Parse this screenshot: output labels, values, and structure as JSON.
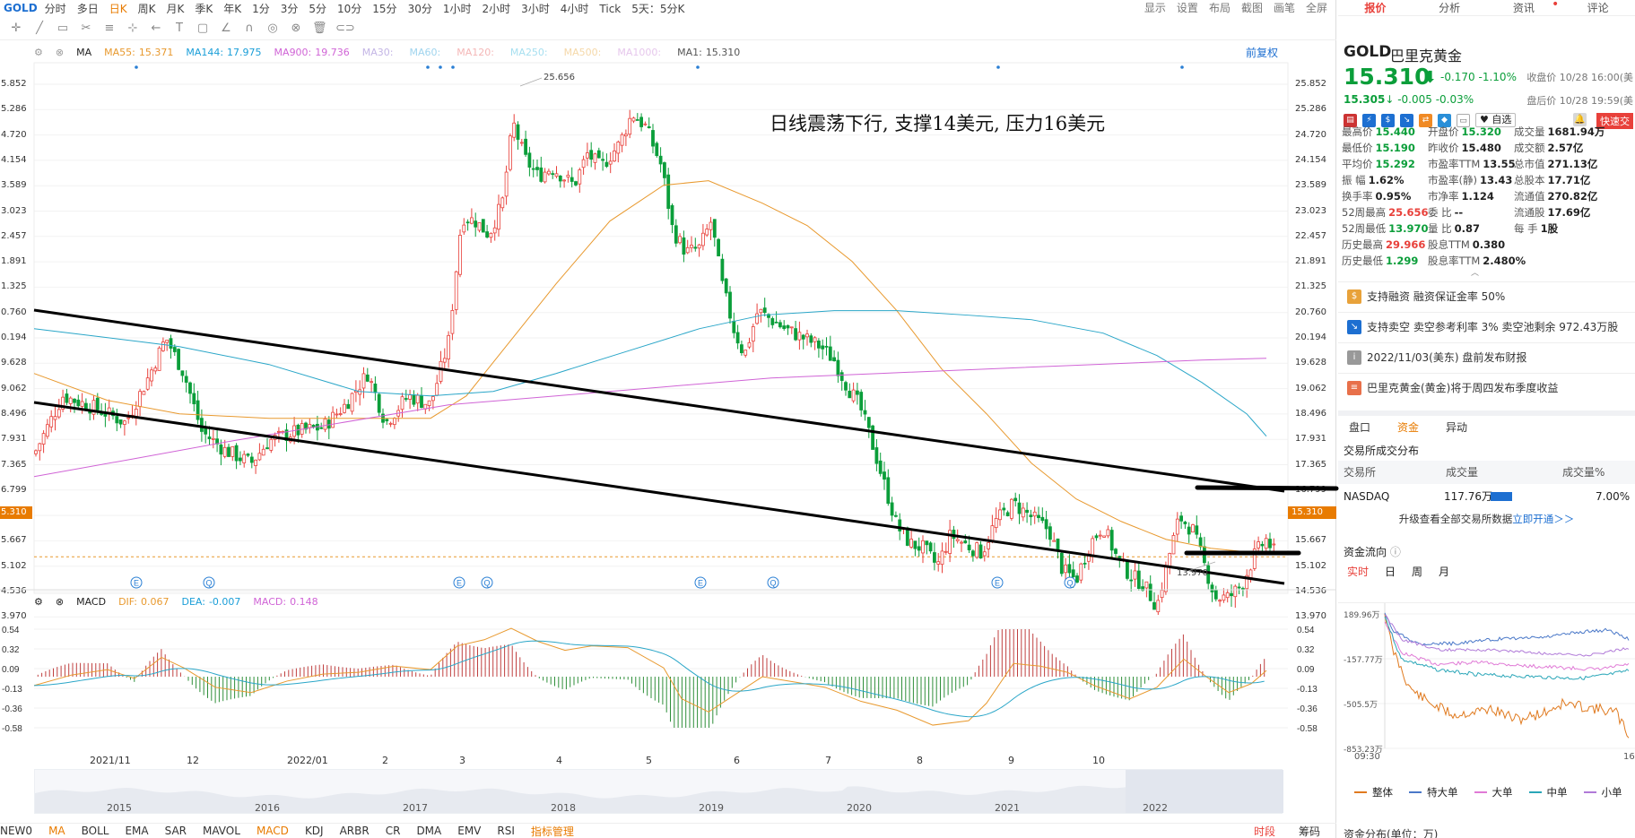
{
  "top": {
    "symbol": "GOLD",
    "periods": [
      "分时",
      "多日",
      "日K",
      "周K",
      "月K",
      "季K",
      "年K",
      "1分",
      "3分",
      "5分",
      "10分",
      "15分",
      "30分",
      "1小时",
      "2小时",
      "3小时",
      "4小时",
      "Tick",
      "5天：5分K"
    ],
    "active_period": "日K",
    "right_items": [
      "显示",
      "设置",
      "布局",
      "截图",
      "画笔",
      "全屏"
    ]
  },
  "toolbar_icons": [
    "crosshair-icon",
    "line-icon",
    "rect-icon",
    "fib-icon",
    "channel-icon",
    "measure-icon",
    "arrow-icon",
    "text-icon",
    "comment-icon",
    "ruler-icon",
    "magnet-icon",
    "eye-icon",
    "lock-icon",
    "trash-icon",
    "group-icon"
  ],
  "main_legend": {
    "name": "MA",
    "items": [
      {
        "label": "MA55:",
        "value": "15.371",
        "color": "#e8992e"
      },
      {
        "label": "MA144:",
        "value": "17.975",
        "color": "#1a9ed8"
      },
      {
        "label": "MA900:",
        "value": "19.736",
        "color": "#d064d6"
      },
      {
        "label": "MA30:",
        "value": "",
        "color": "#c3b5e5"
      },
      {
        "label": "MA60:",
        "value": "",
        "color": "#9fd4ee"
      },
      {
        "label": "MA120:",
        "value": "",
        "color": "#f4b7b7"
      },
      {
        "label": "MA250:",
        "value": "",
        "color": "#a6dff0"
      },
      {
        "label": "MA500:",
        "value": "",
        "color": "#f5d8a8"
      },
      {
        "label": "MA1000:",
        "value": "",
        "color": "#e6c7ec"
      },
      {
        "label": "MA1:",
        "value": "15.310",
        "color": "#555555"
      }
    ],
    "recover": "前复权"
  },
  "yaxis": [
    "25.852",
    "25.286",
    "24.720",
    "24.154",
    "23.589",
    "23.023",
    "22.457",
    "21.891",
    "21.325",
    "20.760",
    "20.194",
    "19.628",
    "19.062",
    "18.496",
    "17.931",
    "17.365",
    "16.799",
    "16.233",
    "15.667",
    "15.102",
    "14.536",
    "13.970"
  ],
  "yaxis_left": [
    "5.852",
    "5.286",
    "4.720",
    "4.154",
    "3.589",
    "3.023",
    "2.457",
    "1.891",
    "1.325",
    "0.760",
    "0.194",
    "9.628",
    "9.062",
    "8.496",
    "7.931",
    "7.365",
    "6.799",
    "6.233",
    "5.667",
    "5.102",
    "4.536",
    "3.970"
  ],
  "current_price_left": "5.310",
  "current_price_right": "15.310",
  "annotation": "日线震荡下行, 支撑14美元, 压力16美元",
  "high_label": "25.656",
  "low_label": "13.970",
  "event_markers": [
    "E",
    "Q",
    "E",
    "Q",
    "E",
    "Q",
    "E",
    "Q"
  ],
  "macd_legend": {
    "name": "MACD",
    "items": [
      {
        "label": "DIF:",
        "value": "0.067",
        "color": "#e8992e"
      },
      {
        "label": "DEA:",
        "value": "-0.007",
        "color": "#1a9ed8"
      },
      {
        "label": "MACD:",
        "value": "0.148",
        "color": "#d064d6"
      }
    ]
  },
  "macd_axis": [
    "0.54",
    "0.32",
    "0.09",
    "-0.13",
    "-0.36",
    "-0.58"
  ],
  "xaxis": [
    "2021/11",
    "12",
    "2022/01",
    "2",
    "3",
    "4",
    "5",
    "6",
    "7",
    "8",
    "9",
    "10"
  ],
  "overview_years": [
    "2015",
    "2016",
    "2017",
    "2018",
    "2019",
    "2020",
    "2021",
    "2022"
  ],
  "indicators": [
    "NEW0",
    "MA",
    "BOLL",
    "EMA",
    "SAR",
    "MAVOL",
    "MACD",
    "KDJ",
    "ARBR",
    "CR",
    "DMA",
    "EMV",
    "RSI",
    "指标管理"
  ],
  "active_indicators": [
    "MA",
    "MACD",
    "指标管理"
  ],
  "indicator_right": [
    "时段",
    "筹码"
  ],
  "right": {
    "tabs": [
      "报价",
      "分析",
      "资讯",
      "评论"
    ],
    "active_tab": "报价",
    "ticker": "GOLD",
    "name_cn": "巴里克黄金",
    "price": "15.310",
    "change": "-0.170",
    "change_pct": "-1.10%",
    "close_time": "收盘价 10/28 16:00(美",
    "after_price": "15.305",
    "after_change": "-0.005",
    "after_pct": "-0.03%",
    "after_time": "盘后价 10/28 19:59(美",
    "watch_label": "自选",
    "quick_trade": "快速交",
    "stats": [
      [
        {
          "k": "最高价",
          "v": "15.440",
          "c": "dn"
        },
        {
          "k": "开盘价",
          "v": "15.320",
          "c": "dn"
        },
        {
          "k": "成交量",
          "v": "1681.94万",
          "c": ""
        }
      ],
      [
        {
          "k": "最低价",
          "v": "15.190",
          "c": "dn"
        },
        {
          "k": "昨收价",
          "v": "15.480",
          "c": ""
        },
        {
          "k": "成交额",
          "v": "2.57亿",
          "c": ""
        }
      ],
      [
        {
          "k": "平均价",
          "v": "15.292",
          "c": "dn"
        },
        {
          "k": "市盈率TTM",
          "v": "13.55",
          "c": ""
        },
        {
          "k": "总市值",
          "v": "271.13亿",
          "c": ""
        }
      ],
      [
        {
          "k": "振    幅",
          "v": "1.62%",
          "c": ""
        },
        {
          "k": "市盈率(静)",
          "v": "13.43",
          "c": ""
        },
        {
          "k": "总股本",
          "v": "17.71亿",
          "c": ""
        }
      ],
      [
        {
          "k": "换手率",
          "v": "0.95%",
          "c": ""
        },
        {
          "k": "市净率",
          "v": "1.124",
          "c": ""
        },
        {
          "k": "流通值",
          "v": "270.82亿",
          "c": ""
        }
      ],
      [
        {
          "k": "52周最高",
          "v": "25.656",
          "c": "up"
        },
        {
          "k": "委    比",
          "v": "--",
          "c": ""
        },
        {
          "k": "流通股",
          "v": "17.69亿",
          "c": ""
        }
      ],
      [
        {
          "k": "52周最低",
          "v": "13.970",
          "c": "dn"
        },
        {
          "k": "量    比",
          "v": "0.87",
          "c": ""
        },
        {
          "k": "每    手",
          "v": "1股",
          "c": ""
        }
      ],
      [
        {
          "k": "历史最高",
          "v": "29.966",
          "c": "up"
        },
        {
          "k": "股息TTM",
          "v": "0.380",
          "c": ""
        },
        {
          "k": "",
          "v": "",
          "c": ""
        }
      ],
      [
        {
          "k": "历史最低",
          "v": "1.299",
          "c": "dn"
        },
        {
          "k": "股息率TTM",
          "v": "2.480%",
          "c": ""
        },
        {
          "k": "",
          "v": "",
          "c": ""
        }
      ]
    ],
    "notices": [
      {
        "text": "支持融资  融资保证金率 50%",
        "icon": "$",
        "color": "#e8a23a"
      },
      {
        "text": "支持卖空  卖空参考利率 3%  卖空池剩余 972.43万股",
        "icon": "↘",
        "color": "#1d6fd1"
      },
      {
        "text": "2022/11/03(美东)  盘前发布财报",
        "icon": "i",
        "color": "#999999"
      },
      {
        "text": "巴里克黄金(黄金)将于周四发布季度收益",
        "icon": "≡",
        "color": "#e8704a"
      }
    ],
    "subtabs": [
      "盘口",
      "资金",
      "异动"
    ],
    "active_subtab": "资金",
    "exchange_title": "交易所成交分布",
    "exchange_headers": [
      "交易所",
      "成交量",
      "成交量%"
    ],
    "exchange_row": {
      "name": "NASDAQ",
      "volume": "117.76万",
      "pct": "7.00%"
    },
    "upgrade_text": "升级查看全部交易所数据",
    "upgrade_link": "立即开通＞＞",
    "flow_title": "资金流向",
    "flow_tabs": [
      "实时",
      "日",
      "周",
      "月"
    ],
    "active_flow_tab": "实时",
    "flow_y": [
      "189.96万",
      "-157.77万",
      "-505.5万",
      "-853.23万"
    ],
    "flow_x": [
      "09:30",
      "16"
    ],
    "flow_legend": [
      {
        "label": "整体",
        "color": "#e07a1f"
      },
      {
        "label": "特大单",
        "color": "#4a78c8"
      },
      {
        "label": "大单",
        "color": "#e07ad6"
      },
      {
        "label": "中单",
        "color": "#2aa6b8"
      },
      {
        "label": "小单",
        "color": "#b07ad8"
      }
    ],
    "capital_dist": "资金分布(单位：万)"
  }
}
